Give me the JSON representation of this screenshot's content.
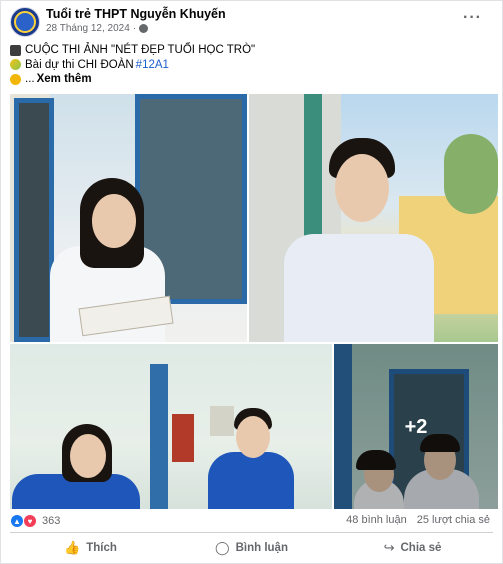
{
  "post": {
    "page_name": "Tuổi trẻ THPT Nguyễn Khuyến",
    "date": "28 Tháng 12, 2024",
    "meta_sep": "·",
    "more_menu": "···",
    "lines": {
      "line1": "CUỘC THI ẢNH \"NÉT ĐẸP TUỔI HỌC TRÒ\"",
      "line2_prefix": "Bài dự thi CHI ĐOÀN",
      "line2_hashtag": "#12A1",
      "line3_prefix": "...",
      "see_more": "Xem thêm"
    }
  },
  "photos": {
    "more_count": "+2"
  },
  "stats": {
    "reaction_count": "363",
    "comments": "48 bình luận",
    "shares": "25 lượt chia sẻ"
  },
  "actions": {
    "like": "Thích",
    "comment": "Bình luận",
    "share": "Chia sẻ"
  },
  "icons": {
    "like_icon": "👍",
    "comment_icon": "◯",
    "share_icon": "↪"
  },
  "colors": {
    "link": "#1b5fcc",
    "like_blue": "#1877f2",
    "love_red": "#f33e58"
  }
}
